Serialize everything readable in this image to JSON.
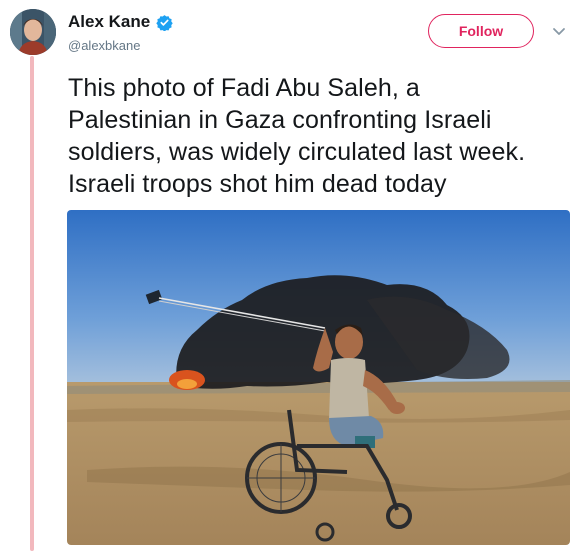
{
  "user": {
    "display_name": "Alex Kane",
    "handle": "@alexbkane",
    "verified": true
  },
  "actions": {
    "follow_label": "Follow"
  },
  "tweet": {
    "lines": [
      "This photo of Fadi Abu Saleh, a",
      "Palestinian in Gaza confronting Israeli",
      "soldiers, was widely circulated last week.",
      "Israeli troops shot him dead today"
    ]
  },
  "icons": {
    "verified": "verified-badge-icon",
    "caret": "chevron-down-icon"
  },
  "colors": {
    "accent": "#e0245e",
    "verified": "#1da1f2",
    "thread_line": "#f2b8bd",
    "name": "#14171a",
    "handle": "#657786"
  }
}
